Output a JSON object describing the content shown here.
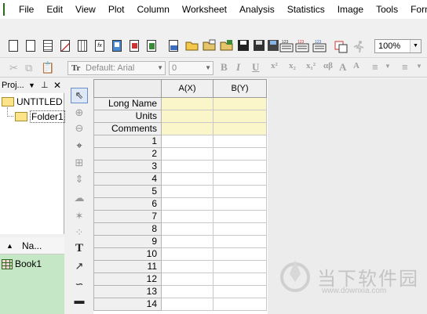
{
  "menubar": {
    "items": [
      "File",
      "Edit",
      "View",
      "Plot",
      "Column",
      "Worksheet",
      "Analysis",
      "Statistics",
      "Image",
      "Tools",
      "Format"
    ]
  },
  "toolbar": {
    "zoom": "100%",
    "font_name": "Default: Arial",
    "font_size": "0"
  },
  "format_buttons": [
    "B",
    "I",
    "U",
    "x²",
    "x₂",
    "x₁²",
    "αβ",
    "A",
    "A"
  ],
  "project": {
    "header_label": "Proj...",
    "root": "UNTITLED",
    "folder": "Folder1",
    "name_column": "Na...",
    "book": "Book1"
  },
  "worksheet": {
    "columns": [
      "A(X)",
      "B(Y)"
    ],
    "meta_rows": [
      "Long Name",
      "Units",
      "Comments"
    ],
    "row_numbers": [
      "1",
      "2",
      "3",
      "4",
      "5",
      "6",
      "7",
      "8",
      "9",
      "10",
      "11",
      "12",
      "13",
      "14"
    ]
  },
  "watermark": {
    "title": "当下软件园",
    "url": "www.downxia.com"
  }
}
